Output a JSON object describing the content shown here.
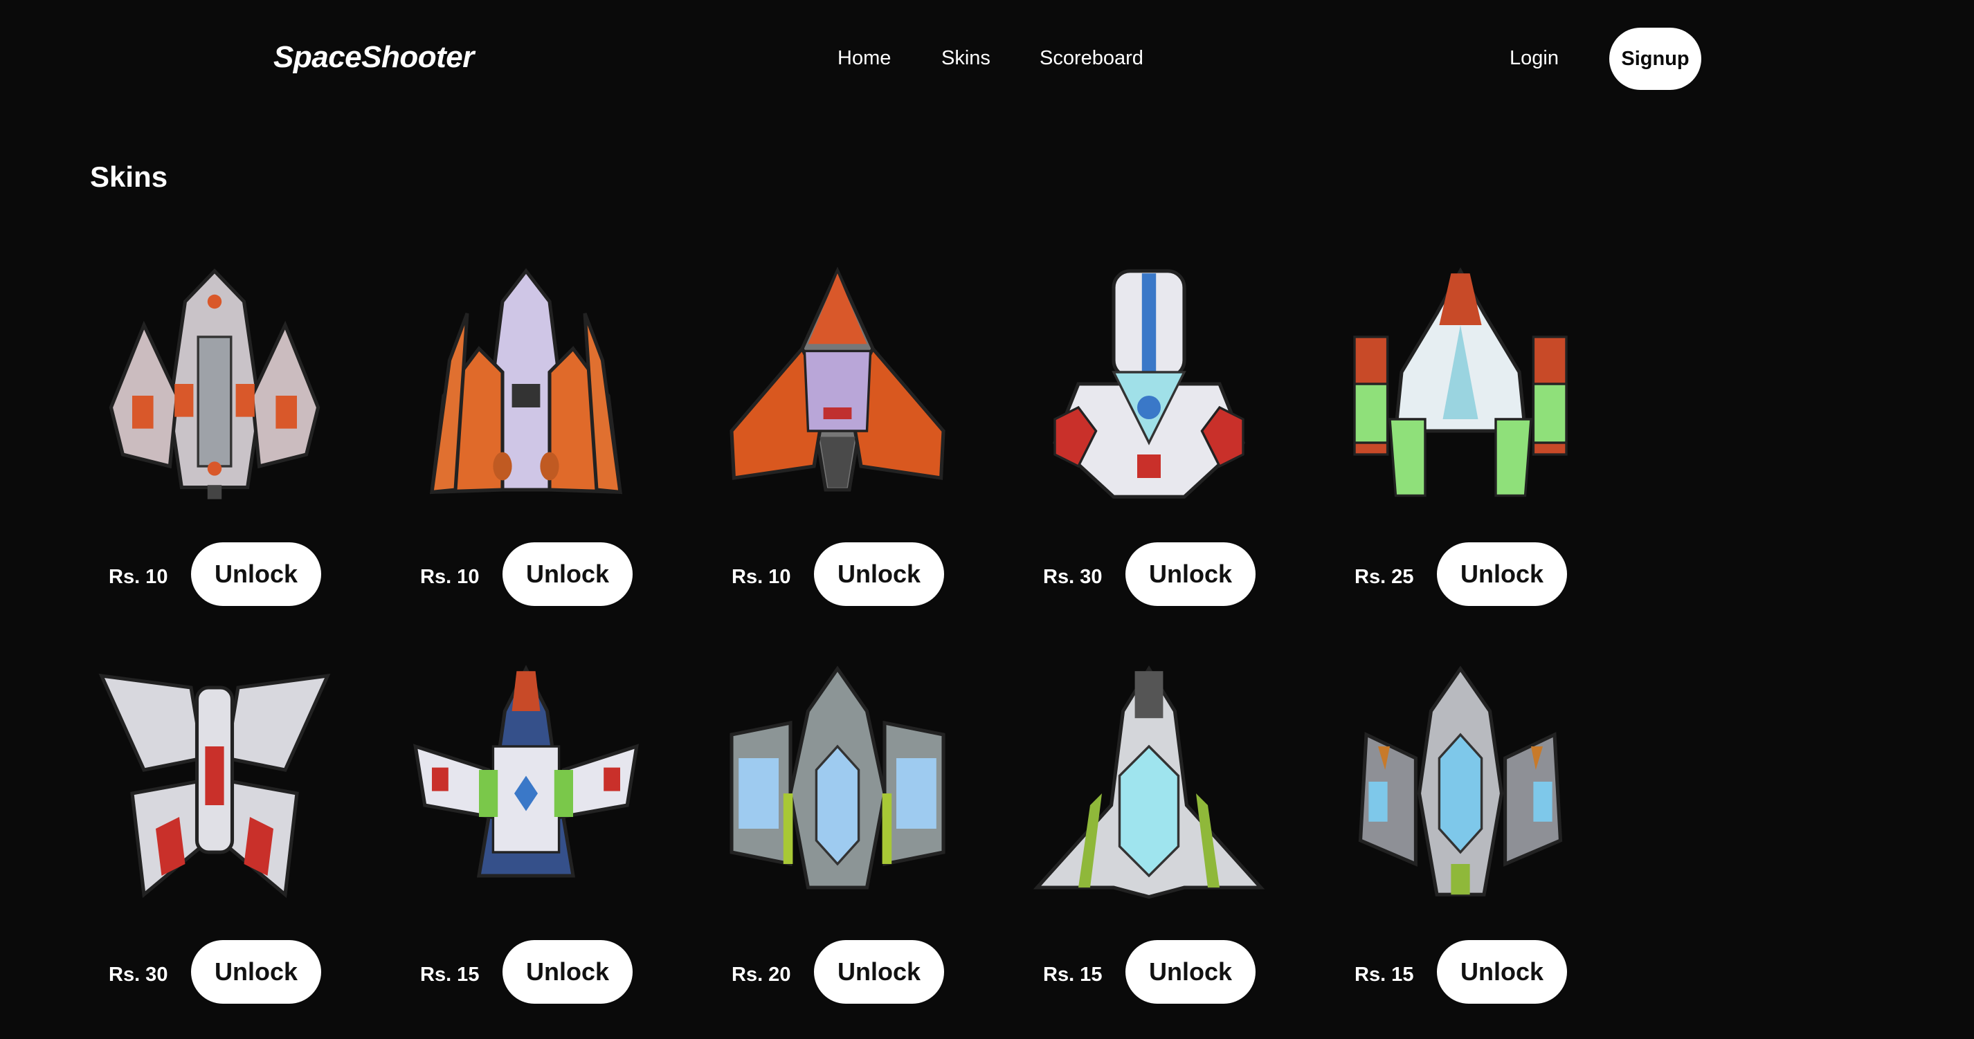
{
  "header": {
    "logo": "SpaceShooter",
    "nav": {
      "home": "Home",
      "skins": "Skins",
      "scoreboard": "Scoreboard"
    },
    "login": "Login",
    "signup": "Signup"
  },
  "section_title": "Skins",
  "skins": [
    {
      "price": "Rs. 10",
      "button": "Unlock",
      "icon": "ship-1-icon",
      "colors": {
        "body": "#c9c3c8",
        "accent": "#d9582a"
      }
    },
    {
      "price": "Rs. 10",
      "button": "Unlock",
      "icon": "ship-2-icon",
      "colors": {
        "body": "#cfc6e6",
        "accent": "#e06a2a"
      }
    },
    {
      "price": "Rs. 10",
      "button": "Unlock",
      "icon": "ship-3-icon",
      "colors": {
        "body": "#b9a6d8",
        "accent": "#d9581f"
      }
    },
    {
      "price": "Rs. 30",
      "button": "Unlock",
      "icon": "ship-4-icon",
      "colors": {
        "body": "#e8e8ee",
        "accent": "#c9302a"
      }
    },
    {
      "price": "Rs. 25",
      "button": "Unlock",
      "icon": "ship-5-icon",
      "colors": {
        "body": "#e6eef2",
        "accent": "#c84a28"
      }
    },
    {
      "price": "Rs. 30",
      "button": "Unlock",
      "icon": "ship-6-icon",
      "colors": {
        "body": "#d8d8de",
        "accent": "#c9302a"
      }
    },
    {
      "price": "Rs. 15",
      "button": "Unlock",
      "icon": "ship-7-icon",
      "colors": {
        "body": "#e6e6ee",
        "accent": "#7ac84a"
      }
    },
    {
      "price": "Rs. 20",
      "button": "Unlock",
      "icon": "ship-8-icon",
      "colors": {
        "body": "#8c9596",
        "accent": "#a8c836"
      }
    },
    {
      "price": "Rs. 15",
      "button": "Unlock",
      "icon": "ship-9-icon",
      "colors": {
        "body": "#d4d6da",
        "accent": "#8fb83a"
      }
    },
    {
      "price": "Rs. 15",
      "button": "Unlock",
      "icon": "ship-10-icon",
      "colors": {
        "body": "#b8babf",
        "accent": "#7ec8ea"
      }
    }
  ]
}
